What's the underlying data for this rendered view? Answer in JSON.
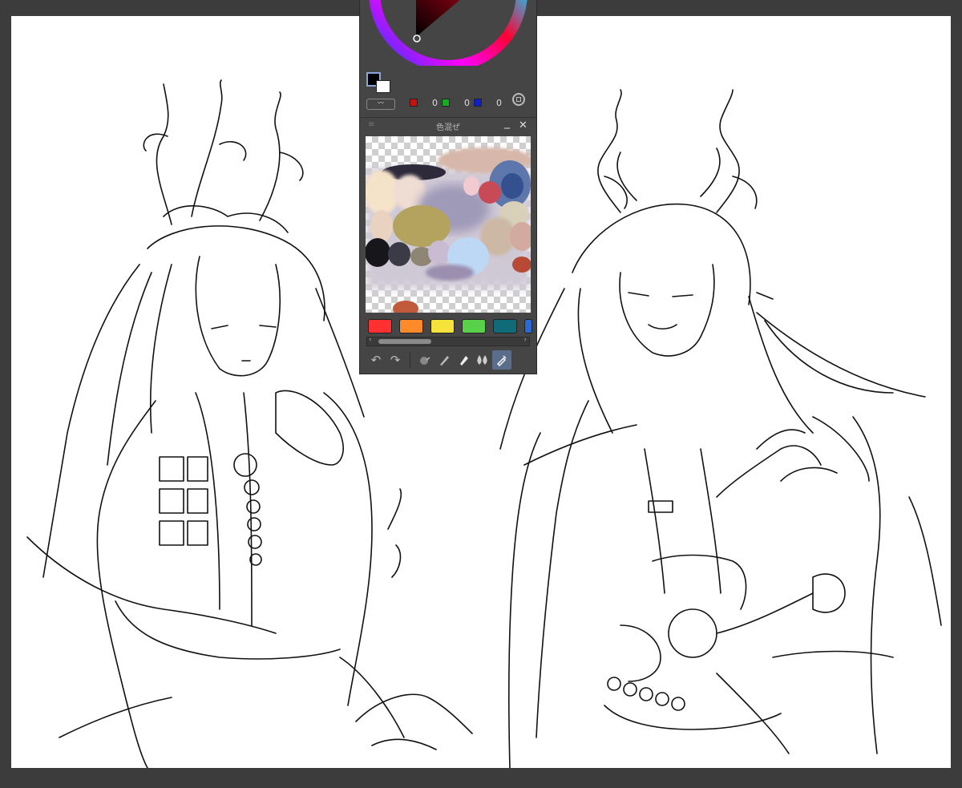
{
  "panel": {
    "rgb": {
      "r": {
        "value": "0",
        "color": "#c81010"
      },
      "g": {
        "value": "0",
        "color": "#10b020"
      },
      "b": {
        "value": "0",
        "color": "#1020c8"
      }
    },
    "main_color": "#000000",
    "sub_color": "#ffffff",
    "swatch_toggle_icon": "swap-pattern-icon",
    "palette_ring_icon": "color-set-icon"
  },
  "mixer": {
    "title": "色混ぜ",
    "menu_icon": "≡",
    "minimize_icon": "_",
    "close_icon": "✕"
  },
  "presets": {
    "colors": [
      "#ff3030",
      "#ff8a2a",
      "#f5e23a",
      "#58d04a",
      "#0f6b78",
      "#2a6ad8"
    ]
  },
  "toolbar": {
    "undo": "↶",
    "redo": "↷",
    "tools": [
      "blend-tool-icon",
      "brush-tool-icon",
      "paint-tube-icon",
      "water-drop-icon",
      "eyedropper-icon"
    ]
  }
}
